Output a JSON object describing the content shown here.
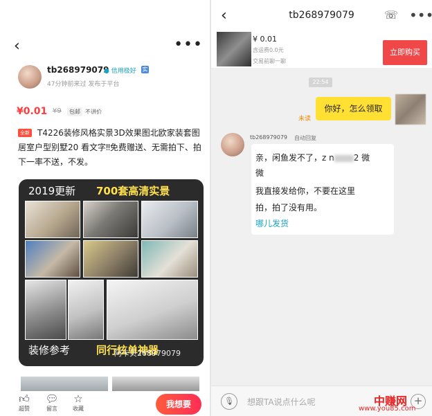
{
  "left": {
    "header": {
      "back": "‹",
      "more": "•••"
    },
    "seller": {
      "name": "tb268979079",
      "credit": "信用极好",
      "verified": "实",
      "last_seen": "47分钟前来过 发布于平台"
    },
    "price": {
      "current": "¥0.01",
      "original": "¥9",
      "ship_tag": "包邮",
      "no_bargain": "不讲价"
    },
    "description": {
      "badge": "全新",
      "text": "T4226装修风格实景3D效果图北欧家装套图居室户型别墅20 看文字‼免费赠送、无需拍下、拍下一率不送，不发。"
    },
    "poster": {
      "title": "2019更新",
      "title_highlight": "700套高清实景",
      "footer": "装修参考",
      "footer_highlight": "同行炫单神器",
      "watermark": "阿卡贝268979079"
    },
    "bottom_bar": {
      "like": "超赞",
      "comment": "留言",
      "favorite": "收藏",
      "want": "我想要"
    }
  },
  "right": {
    "header": {
      "back": "‹",
      "title": "tb268979079",
      "more": "•••"
    },
    "product": {
      "price": "¥ 0.01",
      "shipping": "含运费0.0元",
      "status": "交易前聊一聊",
      "buy": "立即购买"
    },
    "time": "22:54",
    "messages": {
      "me": {
        "text": "你好，怎么领取",
        "status": "未读"
      },
      "seller": {
        "name": "tb268979079",
        "auto_reply": "自动回复",
        "line1_a": "亲，闲鱼发不了，z n",
        "line1_b": "2 微",
        "line2": "微",
        "line3": "我直接发给你，不要在这里",
        "line4": "拍，拍了没有用。",
        "link": "哪儿发货"
      }
    },
    "input": {
      "placeholder": "想跟TA说点什么呢"
    }
  },
  "watermark": {
    "brand": "中赚网",
    "url": "www.you85.com"
  },
  "colors": {
    "accent_red": "#ff3d3d",
    "link_blue": "#1aa3c3",
    "bubble_yellow": "#ffe033"
  }
}
